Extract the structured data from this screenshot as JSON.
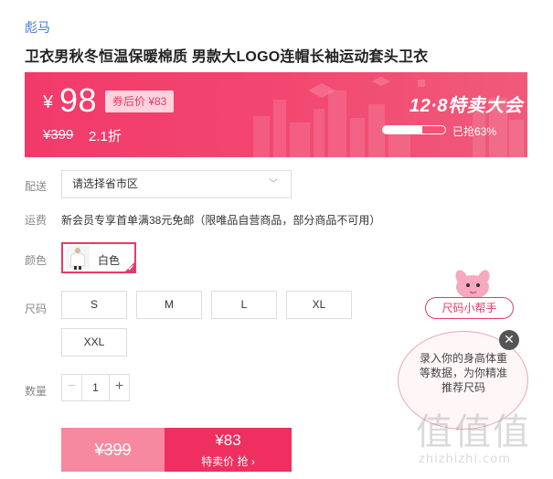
{
  "brand": "彪马",
  "title": "卫衣男秋冬恒温保暖棉质 男款大LOGO连帽长袖运动套头卫衣",
  "price_banner": {
    "currency": "¥",
    "price": "98",
    "coupon_label": "券后价 ¥83",
    "original_price": "¥399",
    "discount": "2.1折",
    "event_name": "12·8特卖大会",
    "sold_percent": 63,
    "sold_label": "已抢63%"
  },
  "delivery": {
    "label": "配送",
    "placeholder": "请选择省市区"
  },
  "shipping": {
    "label": "运费",
    "text": "新会员专享首单满38元免邮（限唯品自营商品，部分商品不可用）"
  },
  "color": {
    "label": "颜色",
    "selected": "白色"
  },
  "size": {
    "label": "尺码",
    "options": [
      "S",
      "M",
      "L",
      "XL",
      "XXL"
    ]
  },
  "quantity": {
    "label": "数量",
    "minus": "−",
    "value": "1",
    "plus": "+"
  },
  "buttons": {
    "original_price": "¥399",
    "flash_price": "¥83",
    "flash_label": "特卖价 抢 ›"
  },
  "size_helper": {
    "tag": "尺码小帮手",
    "text": "录入你的身高体重等数据，为你精准推荐尺码",
    "close": "✕"
  },
  "watermark": {
    "big": "值值值",
    "small": "zhizhizhi.com"
  },
  "colors": {
    "accent": "#e83a67",
    "banner": "#f23a6a",
    "link": "#3b7bd6"
  }
}
